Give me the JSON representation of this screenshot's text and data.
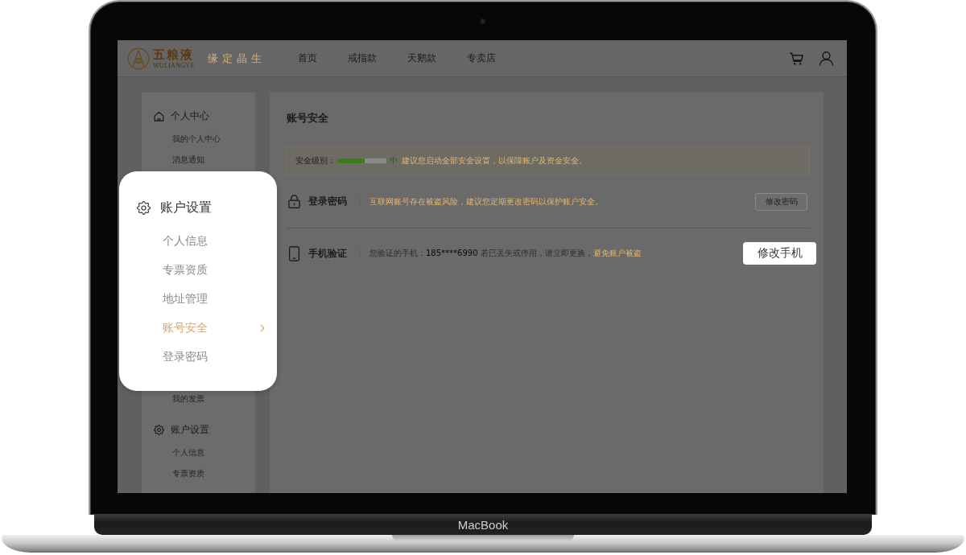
{
  "device": {
    "label": "MacBook"
  },
  "header": {
    "brand": {
      "name": "五粮液",
      "latin": "WULIANGYE"
    },
    "slogan": "缘定晶生",
    "nav": [
      {
        "label": "首页"
      },
      {
        "label": "戒指款"
      },
      {
        "label": "天鹅款"
      },
      {
        "label": "专卖店"
      }
    ]
  },
  "sidebar": {
    "groups": [
      {
        "title": "个人中心",
        "items": [
          "我的个人中心",
          "消息通知"
        ]
      },
      {
        "items": [
          "我的发票"
        ]
      },
      {
        "title": "账户设置",
        "items": [
          "个人信息",
          "专票资质"
        ]
      }
    ]
  },
  "content": {
    "title": "账号安全",
    "security": {
      "label": "安全级别：",
      "level": 0.55,
      "rating": "中",
      "advice": "建议您启动全部安全设置，以保障账户及资金安全。"
    },
    "rows": [
      {
        "title": "登录密码",
        "description": [
          {
            "kind": "warning",
            "text": "互联网账号存在被盗风险，建议您定期更改密码以保护账户安全。"
          }
        ],
        "button": {
          "label": "修改密码",
          "highlighted": false
        }
      },
      {
        "title": "手机验证",
        "description": [
          {
            "kind": "plain",
            "text": "您验证的手机："
          },
          {
            "kind": "strong",
            "text": "185****6990"
          },
          {
            "kind": "plain",
            "text": " 若已丢失或停用，请立即更换，"
          },
          {
            "kind": "warning",
            "text": "避免账户被盗"
          }
        ],
        "button": {
          "label": "修改手机",
          "highlighted": true
        }
      }
    ]
  },
  "spotlight_menu": {
    "title": "账户设置",
    "items": [
      {
        "label": "个人信息",
        "selected": false
      },
      {
        "label": "专票资质",
        "selected": false
      },
      {
        "label": "地址管理",
        "selected": false
      },
      {
        "label": "账号安全",
        "selected": true
      },
      {
        "label": "登录密码",
        "selected": false
      }
    ]
  }
}
